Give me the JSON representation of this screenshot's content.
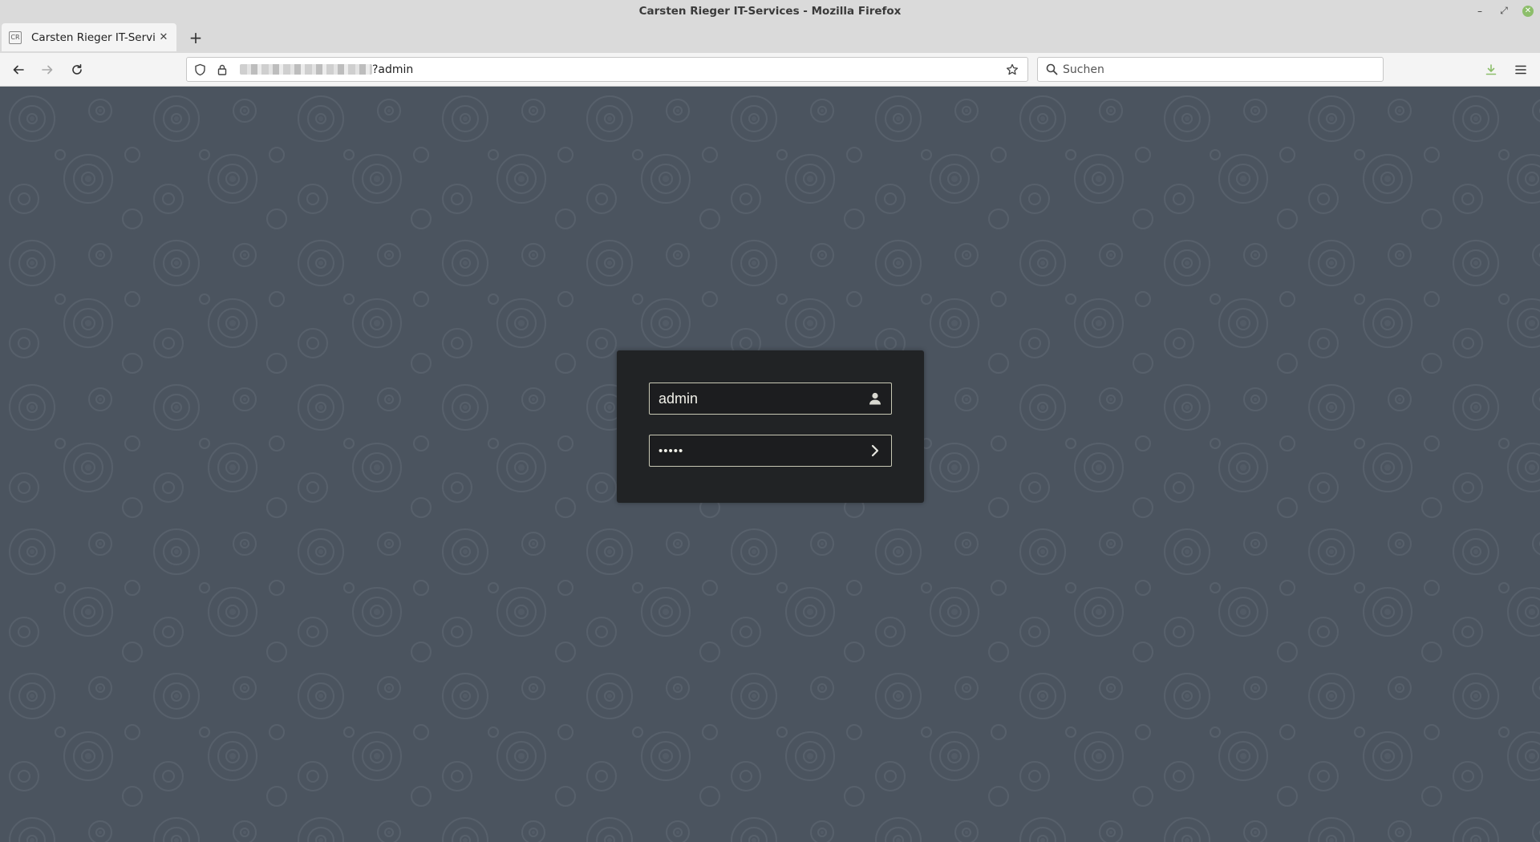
{
  "window": {
    "title": "Carsten Rieger IT-Services - Mozilla Firefox",
    "controls": {
      "minimize": "–",
      "maximize": "⤢",
      "close": "✕"
    }
  },
  "tabs": [
    {
      "favicon_text": "CR",
      "title": "Carsten Rieger IT-Services",
      "close": "✕",
      "active": true
    }
  ],
  "new_tab_label": "+",
  "nav": {
    "back_icon": "arrow-left-icon",
    "forward_icon": "arrow-right-icon",
    "reload_icon": "reload-icon"
  },
  "urlbar": {
    "visible_url_suffix": "?admin",
    "host_blurred": true
  },
  "searchbar": {
    "placeholder": "Suchen"
  },
  "login": {
    "username_value": "admin",
    "password_masked": "•••••",
    "user_icon": "user-icon",
    "submit_icon": "chevron-right-icon"
  },
  "colors": {
    "page_background": "#4b545f",
    "login_box": "#212325",
    "field_border": "#c8c8b4",
    "download_icon": "#8cbe6a"
  }
}
